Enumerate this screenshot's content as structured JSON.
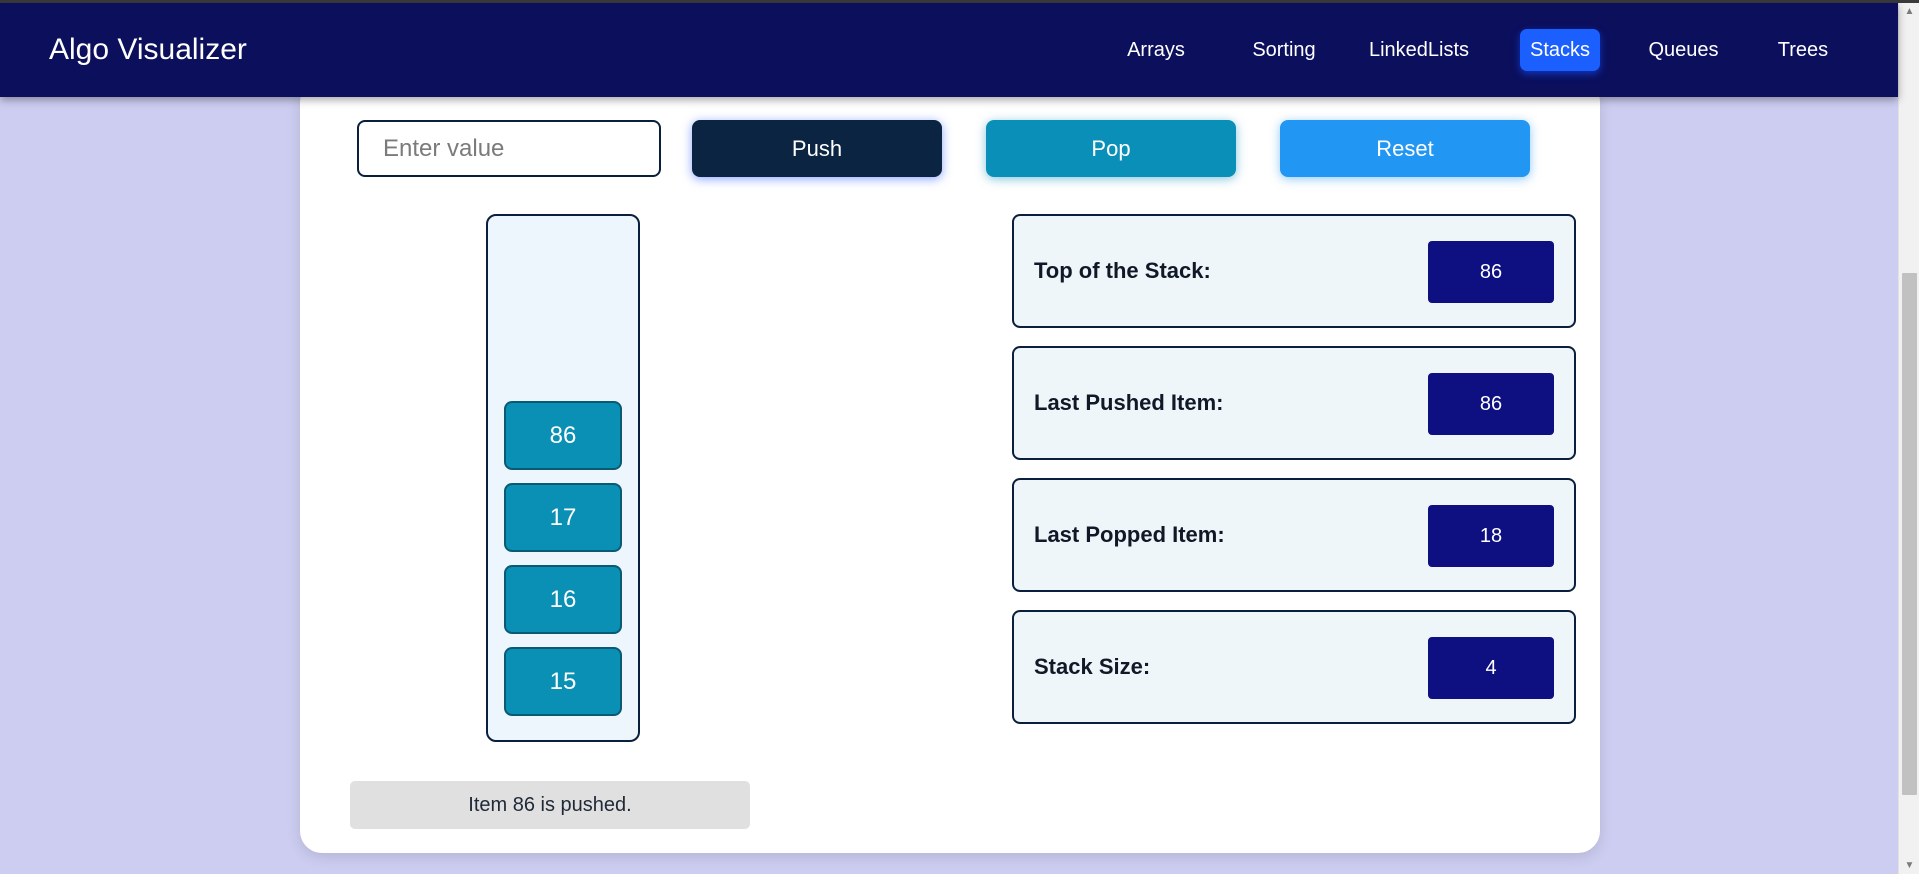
{
  "navbar": {
    "brand": "Algo Visualizer",
    "links": [
      "Arrays",
      "Sorting",
      "LinkedLists",
      "Stacks",
      "Queues",
      "Trees"
    ],
    "active": "Stacks"
  },
  "controls": {
    "input_placeholder": "Enter value",
    "input_value": "",
    "push_label": "Push",
    "pop_label": "Pop",
    "reset_label": "Reset"
  },
  "stack": {
    "items": [
      "86",
      "17",
      "16",
      "15"
    ]
  },
  "info": {
    "top_label": "Top of the Stack:",
    "top_value": "86",
    "pushed_label": "Last Pushed Item:",
    "pushed_value": "86",
    "popped_label": "Last Popped Item:",
    "popped_value": "18",
    "size_label": "Stack Size:",
    "size_value": "4"
  },
  "status": {
    "message": "Item 86 is pushed."
  },
  "colors": {
    "navbar": "#0b0f5c",
    "active_tab": "#1b5fff",
    "push_button": "#0a2442",
    "pop_button": "#0a90b8",
    "reset_button": "#2196f3",
    "stack_item": "#0a8fb5",
    "info_value_bg": "#0e0f80",
    "page_bg": "#cdcdf1"
  }
}
